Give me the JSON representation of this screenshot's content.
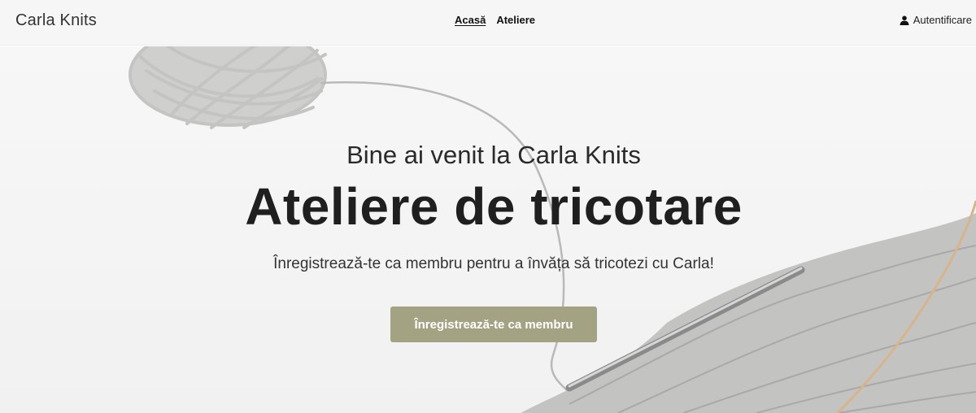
{
  "brand": "Carla Knits",
  "nav": {
    "items": [
      {
        "label": "Acasă",
        "active": true
      },
      {
        "label": "Ateliere",
        "active": false
      }
    ],
    "login_label": "Autentificare",
    "login_icon": "user-icon"
  },
  "hero": {
    "subtitle": "Bine ai venit la Carla Knits",
    "title": "Ateliere de tricotare",
    "text": "Înregistrează-te ca membru pentru a învăța să tricotezi cu Carla!",
    "cta_label": "Înregistrează-te ca membru"
  },
  "colors": {
    "navbar_bg": "#f6f6f6",
    "cta_bg": "#a3a383",
    "yarn": "#c9c9c7"
  }
}
